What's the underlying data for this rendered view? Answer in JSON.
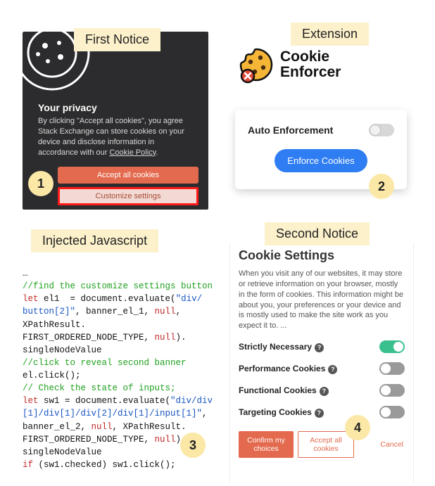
{
  "tags": {
    "first_notice": "First Notice",
    "extension": "Extension",
    "injected_js": "Injected Javascript",
    "second_notice": "Second Notice"
  },
  "steps": {
    "s1": "1",
    "s2": "2",
    "s3": "3",
    "s4": "4"
  },
  "panel1": {
    "title": "Your privacy",
    "body_pre": "By clicking \"Accept all cookies\", you agree Stack Exchange can store cookies on your device and disclose information in accordance with our ",
    "policy_link": "Cookie Policy",
    "body_post": ".",
    "accept": "Accept all cookies",
    "customize": "Customize settings"
  },
  "panel2": {
    "name_line1": "Cookie",
    "name_line2": "Enforcer",
    "auto_label": "Auto Enforcement",
    "enforce": "Enforce Cookies"
  },
  "panel3": {
    "l0": "…",
    "l1": "//find the customize settings button",
    "l2a": "let",
    "l2b": " el1  = document.evaluate(",
    "l2c": "\"div/",
    "l3a": "button[2]\"",
    "l3b": ", banner_el_1, ",
    "l3c": "null",
    "l3d": ",",
    "l4": "XPathResult.",
    "l5a": "FIRST_ORDERED_NODE_TYPE, ",
    "l5b": "null",
    "l5c": ").",
    "l6": "singleNodeValue",
    "l7": "//click to reveal second banner",
    "l8": "el.click();",
    "l9": "// Check the state of inputs;",
    "l10a": "let",
    "l10b": " sw1 = document.evaluate(",
    "l10c": "\"div/div",
    "l11": "[1]/div[1]/div[2]/div[1]/input[1]\"",
    "l12a": "banner_el_2, ",
    "l12b": "null",
    "l12c": ", XPathResult.",
    "l13a": "FIRST_ORDERED_NODE_TYPE, ",
    "l13b": "null",
    "l13c": ")",
    "l14": "singleNodeValue",
    "l15a": "if",
    "l15b": " (sw1.checked) sw1.click();"
  },
  "panel4": {
    "heading": "Cookie Settings",
    "desc": "When you visit any of our websites, it may store or retrieve information on your browser, mostly in the form of cookies. This information might be about you, your preferences or your device and is mostly used to make the site work as you expect it to. ...",
    "toggles": [
      {
        "label": "Strictly Necessary",
        "on": true
      },
      {
        "label": "Performance Cookies",
        "on": false
      },
      {
        "label": "Functional Cookies",
        "on": false
      },
      {
        "label": "Targeting Cookies",
        "on": false
      }
    ],
    "confirm": "Confirm my choices",
    "accept_all": "Accept all cookies",
    "cancel": "Cancel"
  }
}
